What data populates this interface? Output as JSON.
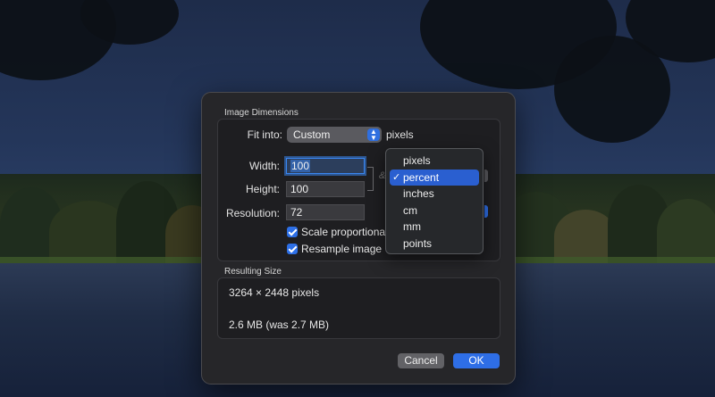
{
  "dialog": {
    "image_dimensions_title": "Image Dimensions",
    "fit_into_label": "Fit into:",
    "fit_into_value": "Custom",
    "fit_into_unit": "pixels",
    "width_label": "Width:",
    "width_value": "100",
    "height_label": "Height:",
    "height_value": "100",
    "resolution_label": "Resolution:",
    "resolution_value": "72",
    "scale_label": "Scale proportional",
    "scale_checked": true,
    "resample_label": "Resample image",
    "resample_checked": true,
    "resulting_size_title": "Resulting Size",
    "result_dimensions": "3264 × 2448 pixels",
    "result_filesize": "2.6 MB (was 2.7 MB)",
    "cancel_label": "Cancel",
    "ok_label": "OK"
  },
  "unit_menu": {
    "items": [
      "pixels",
      "percent",
      "inches",
      "cm",
      "mm",
      "points"
    ],
    "selected": "percent",
    "check_glyph": "✓"
  },
  "colors": {
    "accent": "#2e6ee6",
    "dialog_bg": "#262629"
  },
  "icons": {
    "chevron": "updown-chevron-icon",
    "lock": "link-lock-icon",
    "checkbox": "checkbox-checked-icon"
  }
}
